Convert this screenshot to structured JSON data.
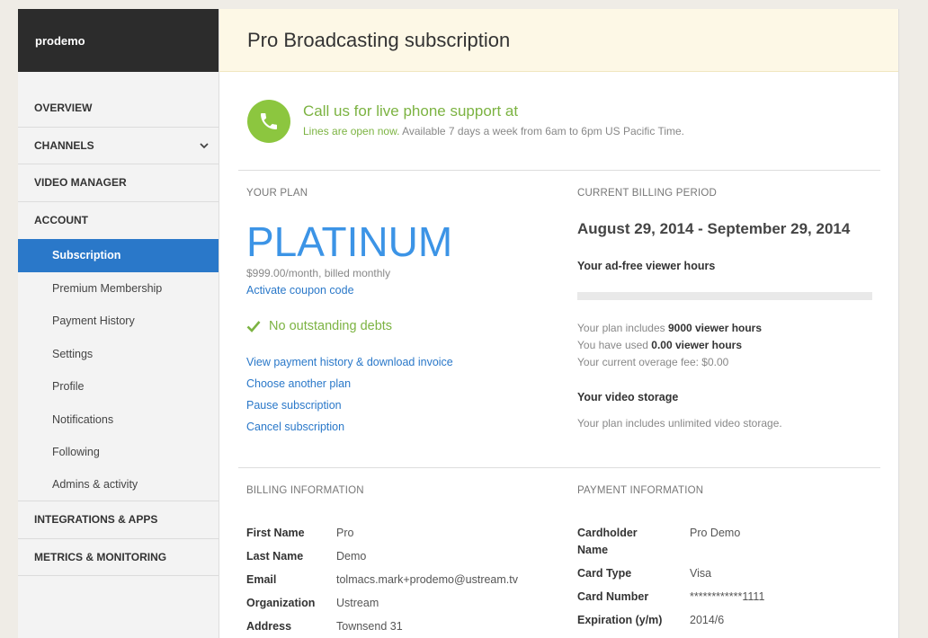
{
  "brand": "prodemo",
  "nav": {
    "overview": "OVERVIEW",
    "channels": "CHANNELS",
    "video_manager": "VIDEO MANAGER",
    "account": "ACCOUNT",
    "sub_items": [
      "Subscription",
      "Premium Membership",
      "Payment History",
      "Settings",
      "Profile",
      "Notifications",
      "Following",
      "Admins & activity"
    ],
    "integrations": "INTEGRATIONS & APPS",
    "metrics": "METRICS & MONITORING"
  },
  "header": {
    "title": "Pro Broadcasting subscription"
  },
  "support": {
    "title": "Call us for live phone support at",
    "lead": "Lines are open now.",
    "hours": " Available 7 days a week from 6am to 6pm US Pacific Time."
  },
  "plan": {
    "label": "YOUR PLAN",
    "name": "PLATINUM",
    "price": "$999.00/month, billed monthly",
    "coupon": "Activate coupon code",
    "debts": "No outstanding debts",
    "links": [
      "View payment history & download invoice",
      "Choose another plan",
      "Pause subscription",
      "Cancel subscription"
    ]
  },
  "billing_period": {
    "label": "CURRENT BILLING PERIOD",
    "range": "August 29, 2014 - September 29, 2014",
    "hours_title": "Your ad-free viewer hours",
    "usage_fraction": 0,
    "includes_pre": "Your plan includes ",
    "includes_val": "9000 viewer hours",
    "used_pre": "You have used ",
    "used_val": "0.00 viewer hours",
    "overage": "Your current overage fee: $0.00",
    "storage_title": "Your video storage",
    "storage_text": "Your plan includes unlimited video storage."
  },
  "billing_info": {
    "label": "BILLING INFORMATION",
    "rows": [
      {
        "k": "First Name",
        "v": "Pro"
      },
      {
        "k": "Last Name",
        "v": "Demo"
      },
      {
        "k": "Email",
        "v": "tolmacs.mark+prodemo@ustream.tv"
      },
      {
        "k": "Organization",
        "v": "Ustream"
      },
      {
        "k": "Address",
        "v": "Townsend 31"
      }
    ]
  },
  "payment_info": {
    "label": "PAYMENT INFORMATION",
    "rows": [
      {
        "k1": "Cardholder",
        "k2": "Name",
        "v": "Pro Demo"
      },
      {
        "k": "Card Type",
        "v": "Visa"
      },
      {
        "k": "Card Number",
        "v": "************1111"
      },
      {
        "k": "Expiration (y/m)",
        "v": "2014/6"
      }
    ]
  },
  "colors": {
    "accent": "#2a78c9",
    "green": "#7cb342",
    "header_bg": "#fdf8e6",
    "sidebar_dark": "#2c2c2c"
  }
}
